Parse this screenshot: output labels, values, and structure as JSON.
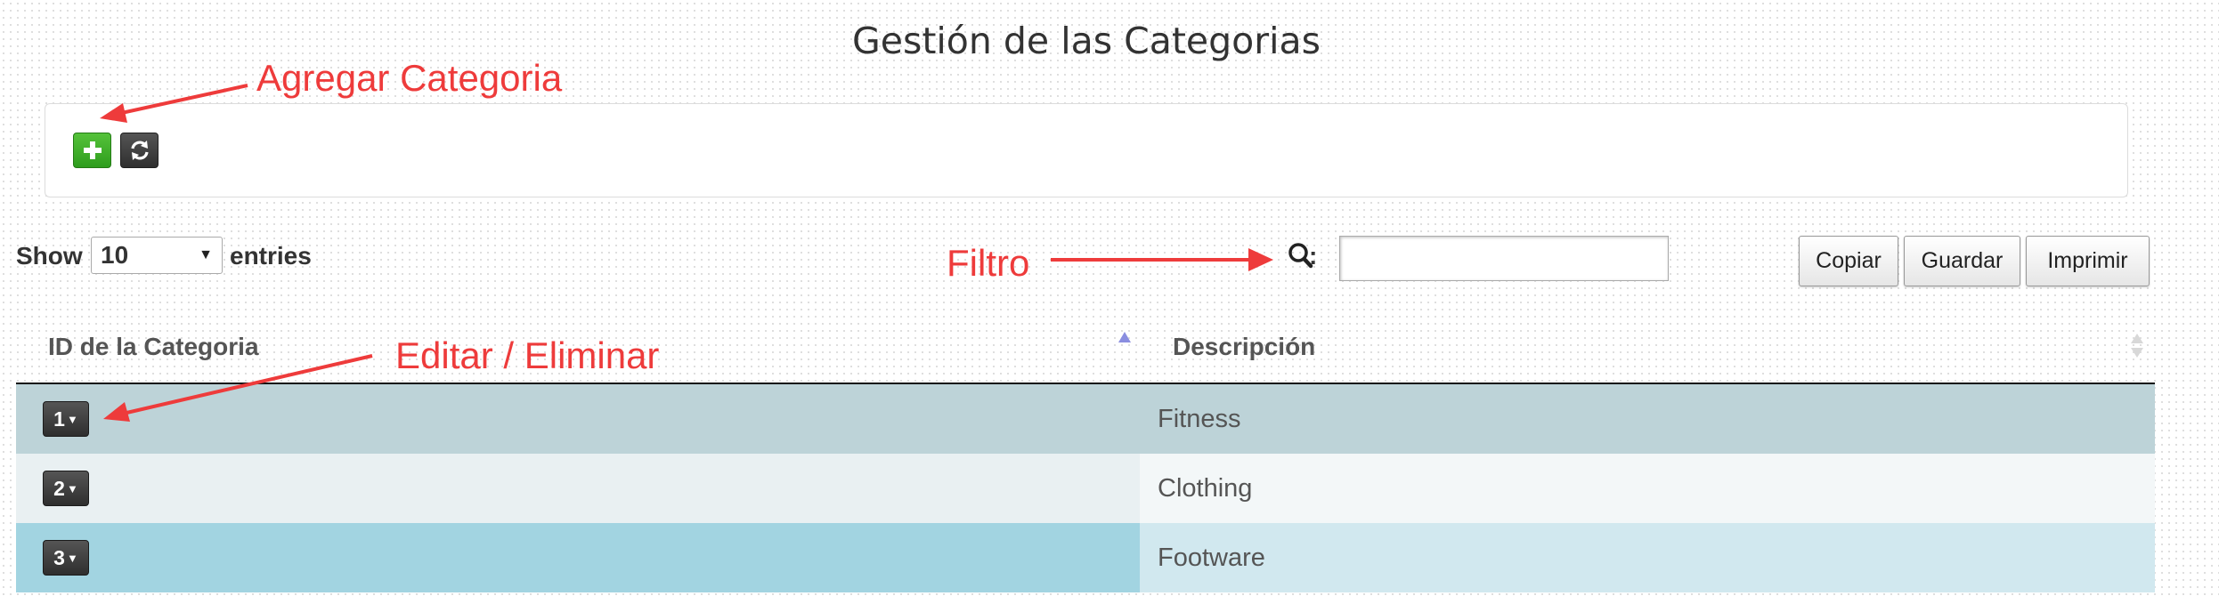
{
  "page": {
    "title": "Gestión de las Categorias"
  },
  "toolbar": {
    "add_icon": "plus-icon",
    "refresh_icon": "refresh-icon",
    "add_color": "#3aaa28",
    "refresh_color": "#3f3f3f"
  },
  "length_menu": {
    "show_label": "Show",
    "selected": "10",
    "entries_label": "entries"
  },
  "search": {
    "icon": "search-icon",
    "colon": ":",
    "value": ""
  },
  "export": {
    "copy_label": "Copiar",
    "save_label": "Guardar",
    "print_label": "Imprimir"
  },
  "table": {
    "columns": [
      "ID de la Categoria",
      "Descripción"
    ],
    "sort_column": "ID de la Categoria",
    "sort_direction": "asc",
    "rows": [
      {
        "id": "1",
        "description": "Fitness",
        "id_bg": "#bdd3d8",
        "desc_bg": "#bdd3d8"
      },
      {
        "id": "2",
        "description": "Clothing",
        "id_bg": "#e9f0f2",
        "desc_bg": "#f3f7f8"
      },
      {
        "id": "3",
        "description": "Footware",
        "id_bg": "#a2d4e1",
        "desc_bg": "#d1e8ef"
      }
    ]
  },
  "annotations": {
    "color": "#ee3b3b",
    "add": "Agregar Categoria",
    "filter": "Filtro",
    "edit": "Editar / Eliminar"
  }
}
